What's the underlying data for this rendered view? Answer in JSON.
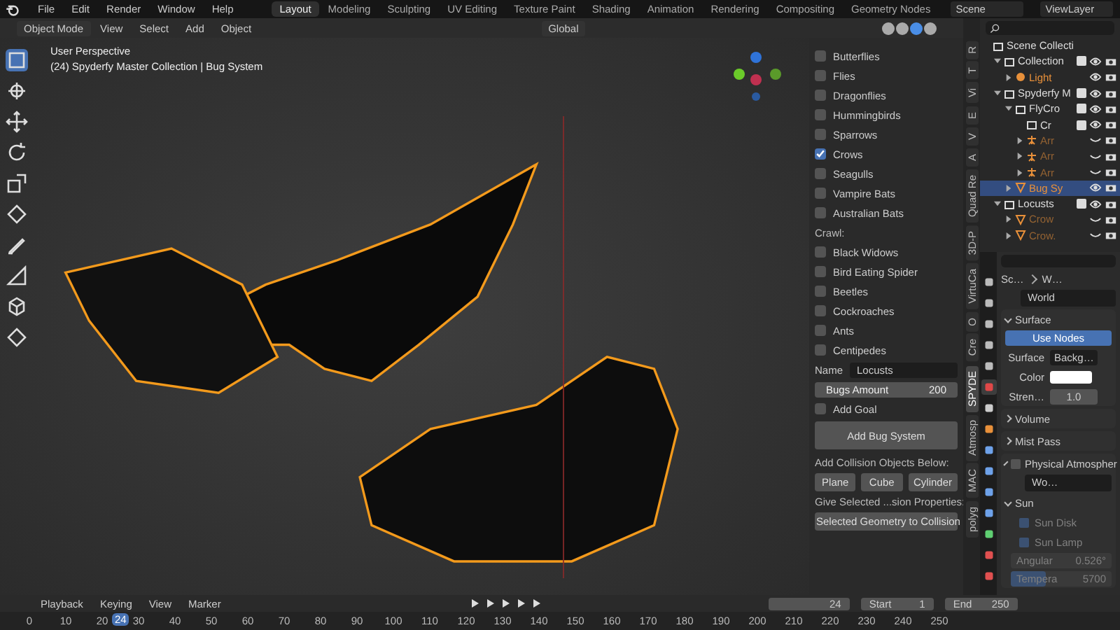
{
  "top_bar": {
    "menus": [
      "File",
      "Edit",
      "Render",
      "Window",
      "Help"
    ],
    "workspaces": [
      {
        "label": "Layout",
        "selected": true
      },
      {
        "label": "Modeling",
        "selected": false
      },
      {
        "label": "Sculpting",
        "selected": false
      },
      {
        "label": "UV Editing",
        "selected": false
      },
      {
        "label": "Texture Paint",
        "selected": false
      },
      {
        "label": "Shading",
        "selected": false
      },
      {
        "label": "Animation",
        "selected": false
      },
      {
        "label": "Rendering",
        "selected": false
      },
      {
        "label": "Compositing",
        "selected": false
      },
      {
        "label": "Geometry Nodes",
        "selected": false
      }
    ],
    "scene": "Scene",
    "view_layer": "ViewLayer"
  },
  "viewport": {
    "mode": "Object Mode",
    "menus": [
      "View",
      "Select",
      "Add",
      "Object"
    ],
    "orientation": "Global",
    "shading_modes": [
      {
        "selected": false
      },
      {
        "selected": false
      },
      {
        "selected": true
      },
      {
        "selected": false
      }
    ],
    "tools": [
      {
        "kind": "select",
        "selected": true
      },
      {
        "kind": "cursor",
        "selected": false
      },
      {
        "kind": "move",
        "selected": false
      },
      {
        "kind": "rotate",
        "selected": false
      },
      {
        "kind": "scale",
        "selected": false
      },
      {
        "kind": "transform",
        "selected": false
      },
      {
        "kind": "annotate",
        "selected": false
      },
      {
        "kind": "measure",
        "selected": false
      },
      {
        "kind": "cube",
        "selected": false
      },
      {
        "kind": "transform",
        "selected": false
      }
    ],
    "info": [
      "User Perspective",
      "(24) Spyderfy Master Collection | Bug System"
    ]
  },
  "n_panel": {
    "rows": [
      {
        "kind": "checkbox",
        "label": "Butterflies",
        "checked": false
      },
      {
        "kind": "checkbox",
        "label": "Flies",
        "checked": false
      },
      {
        "kind": "checkbox",
        "label": "Dragonflies",
        "checked": false
      },
      {
        "kind": "checkbox",
        "label": "Hummingbirds",
        "checked": false
      },
      {
        "kind": "checkbox",
        "label": "Sparrows",
        "checked": false
      },
      {
        "kind": "checkbox",
        "label": "Crows",
        "checked": true
      },
      {
        "kind": "checkbox",
        "label": "Seagulls",
        "checked": false
      },
      {
        "kind": "checkbox",
        "label": "Vampire Bats",
        "checked": false
      },
      {
        "kind": "checkbox",
        "label": "Australian Bats",
        "checked": false
      },
      {
        "kind": "label",
        "label": "Crawl:"
      },
      {
        "kind": "checkbox",
        "label": "Black Widows",
        "checked": false
      },
      {
        "kind": "checkbox",
        "label": "Bird Eating Spider",
        "checked": false
      },
      {
        "kind": "checkbox",
        "label": "Beetles",
        "checked": false
      },
      {
        "kind": "checkbox",
        "label": "Cockroaches",
        "checked": false
      },
      {
        "kind": "checkbox",
        "label": "Ants",
        "checked": false
      },
      {
        "kind": "checkbox",
        "label": "Centipedes",
        "checked": false
      },
      {
        "kind": "field",
        "label": "Name",
        "value": "Locusts"
      },
      {
        "kind": "number",
        "label": "Bugs Amount",
        "value": "200"
      },
      {
        "kind": "checkbox",
        "label": "Add Goal",
        "checked": false
      },
      {
        "kind": "big_button",
        "label": "Add Bug System"
      },
      {
        "kind": "label",
        "label": "Add Collision Objects Below:"
      },
      {
        "kind": "buttons",
        "labels": [
          "Plane",
          "Cube",
          "Cylinder"
        ]
      },
      {
        "kind": "label",
        "label": "Give Selected ...sion Properties:"
      },
      {
        "kind": "button",
        "label": "Selected Geometry to Collision"
      }
    ]
  },
  "side_tabs": [
    {
      "label": "R",
      "selected": false
    },
    {
      "label": "T",
      "selected": false
    },
    {
      "label": "Vi",
      "selected": false
    },
    {
      "label": "E",
      "selected": false
    },
    {
      "label": "V",
      "selected": false
    },
    {
      "label": "A",
      "selected": false
    },
    {
      "label": "Quad Re",
      "selected": false
    },
    {
      "label": "3D-P",
      "selected": false
    },
    {
      "label": "VirtuCa",
      "selected": false
    },
    {
      "label": "O",
      "selected": false
    },
    {
      "label": "Cre",
      "selected": false
    },
    {
      "label": "SPYDE",
      "selected": true
    },
    {
      "label": "Atmosp",
      "selected": false
    },
    {
      "label": "MAC",
      "selected": false
    },
    {
      "label": "polyg",
      "selected": false
    }
  ],
  "outliner": {
    "items": [
      {
        "name": "Scene Collecti",
        "kind": "collection",
        "children": [
          {
            "name": "Collection",
            "kind": "collection",
            "expanded": true,
            "checked": true,
            "visible": true,
            "selected": false,
            "children": [
              {
                "name": "Light",
                "kind": "light",
                "expanded": false,
                "visible": true,
                "selected": false
              }
            ]
          },
          {
            "name": "Spyderfy M",
            "kind": "collection",
            "expanded": true,
            "checked": true,
            "visible": true,
            "selected": false,
            "children": [
              {
                "name": "FlyCro",
                "kind": "collection",
                "expanded": true,
                "checked": true,
                "visible": true,
                "selected": false,
                "children": [
                  {
                    "name": "Cr",
                    "kind": "collection",
                    "checked": true,
                    "visible": true,
                    "selected": false
                  },
                  {
                    "name": "Arr",
                    "kind": "armature",
                    "expanded": false,
                    "visible": false,
                    "selected": false
                  },
                  {
                    "name": "Arr",
                    "kind": "armature",
                    "expanded": false,
                    "visible": false,
                    "selected": false
                  },
                  {
                    "name": "Arr",
                    "kind": "armature",
                    "expanded": false,
                    "visible": false,
                    "selected": false
                  }
                ]
              },
              {
                "name": "Bug Sy",
                "kind": "bug",
                "expanded": false,
                "visible": true,
                "selected": true
              }
            ]
          },
          {
            "name": "Locusts",
            "kind": "collection",
            "expanded": true,
            "checked": true,
            "visible": true,
            "selected": false,
            "children": [
              {
                "name": "Crow",
                "kind": "bug",
                "expanded": false,
                "visible": false,
                "selected": false
              },
              {
                "name": "Crow.",
                "kind": "bug",
                "expanded": false,
                "visible": false,
                "selected": false
              }
            ]
          }
        ]
      }
    ]
  },
  "properties": {
    "tabs": [
      {
        "kind": "tool",
        "selected": false
      },
      {
        "kind": "render",
        "selected": false
      },
      {
        "kind": "output",
        "selected": false
      },
      {
        "kind": "view_layer",
        "selected": false
      },
      {
        "kind": "scene",
        "selected": false
      },
      {
        "kind": "world",
        "selected": true
      },
      {
        "kind": "collection",
        "selected": false
      },
      {
        "kind": "object",
        "selected": false
      },
      {
        "kind": "modifier",
        "selected": false
      },
      {
        "kind": "particles",
        "selected": false
      },
      {
        "kind": "physics",
        "selected": false
      },
      {
        "kind": "constraint",
        "selected": false
      },
      {
        "kind": "data",
        "selected": false
      },
      {
        "kind": "material",
        "selected": false
      },
      {
        "kind": "texture",
        "selected": false
      }
    ],
    "breadcrumb": [
      "Sc…",
      "W…"
    ],
    "world": "World",
    "surface": {
      "title": "Surface",
      "expanded": true,
      "use_nodes": "Use Nodes",
      "surface_label": "Surface",
      "surface_value": "Backg…",
      "color_label": "Color",
      "color": "#ffffff",
      "strength_label": "Stren…",
      "strength": "1.0"
    },
    "collapsed_panels": [
      {
        "title": "Volume",
        "expanded": false
      },
      {
        "title": "Mist Pass",
        "expanded": false
      }
    ],
    "atmosphere": {
      "title": "Physical Atmospher",
      "expanded": true,
      "checked": false,
      "world": "Wo…",
      "sun": {
        "title": "Sun",
        "expanded": true,
        "options": [
          {
            "label": "Sun Disk",
            "checked": true
          },
          {
            "label": "Sun Lamp",
            "checked": true
          }
        ],
        "fields": [
          {
            "label": "Angular",
            "value": "0.526°"
          },
          {
            "label": "Tempera",
            "value": "5700",
            "level": 0.35
          }
        ]
      }
    }
  },
  "timeline": {
    "menus": [
      "Playback",
      "Keying",
      "View",
      "Marker"
    ],
    "frame": "24",
    "start_label": "Start",
    "start": "1",
    "end_label": "End",
    "end": "250",
    "ticks": [
      "0",
      "10",
      "20",
      "30",
      "40",
      "50",
      "60",
      "70",
      "80",
      "90",
      "100",
      "110",
      "120",
      "130",
      "140",
      "150",
      "160",
      "170",
      "180",
      "190",
      "200",
      "210",
      "220",
      "230",
      "240",
      "250"
    ],
    "current": "24"
  }
}
